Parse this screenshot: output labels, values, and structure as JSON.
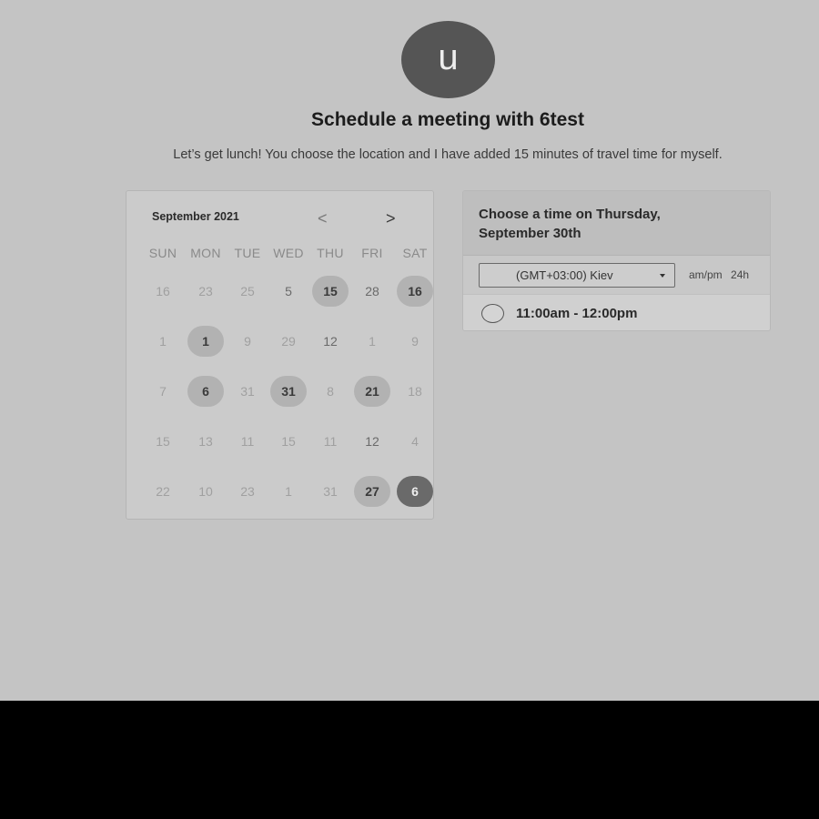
{
  "header": {
    "avatar_letter": "u",
    "title": "Schedule a meeting with 6test",
    "description": "Let’s get lunch! You choose the location and I have added 15 minutes of travel time for myself."
  },
  "calendar": {
    "month_label": "September 2021",
    "prev_glyph": "<",
    "next_glyph": ">",
    "weekdays": [
      "SUN",
      "MON",
      "TUE",
      "WED",
      "THU",
      "FRI",
      "SAT"
    ],
    "weeks": [
      [
        {
          "label": "16",
          "state": "muted"
        },
        {
          "label": "23",
          "state": "muted"
        },
        {
          "label": "25",
          "state": "muted"
        },
        {
          "label": "5",
          "state": "mid"
        },
        {
          "label": "15",
          "state": "available"
        },
        {
          "label": "28",
          "state": "mid"
        },
        {
          "label": "16",
          "state": "available"
        }
      ],
      [
        {
          "label": "1",
          "state": "muted"
        },
        {
          "label": "1",
          "state": "available"
        },
        {
          "label": "9",
          "state": "muted"
        },
        {
          "label": "29",
          "state": "muted"
        },
        {
          "label": "12",
          "state": "mid"
        },
        {
          "label": "1",
          "state": "muted"
        },
        {
          "label": "9",
          "state": "muted"
        }
      ],
      [
        {
          "label": "7",
          "state": "muted"
        },
        {
          "label": "6",
          "state": "available"
        },
        {
          "label": "31",
          "state": "muted"
        },
        {
          "label": "31",
          "state": "available"
        },
        {
          "label": "8",
          "state": "muted"
        },
        {
          "label": "21",
          "state": "available"
        },
        {
          "label": "18",
          "state": "muted"
        }
      ],
      [
        {
          "label": "15",
          "state": "muted"
        },
        {
          "label": "13",
          "state": "muted"
        },
        {
          "label": "11",
          "state": "muted"
        },
        {
          "label": "15",
          "state": "muted"
        },
        {
          "label": "11",
          "state": "muted"
        },
        {
          "label": "12",
          "state": "mid"
        },
        {
          "label": "4",
          "state": "muted"
        }
      ],
      [
        {
          "label": "22",
          "state": "muted"
        },
        {
          "label": "10",
          "state": "muted"
        },
        {
          "label": "23",
          "state": "muted"
        },
        {
          "label": "1",
          "state": "muted"
        },
        {
          "label": "31",
          "state": "muted"
        },
        {
          "label": "27",
          "state": "available"
        },
        {
          "label": "6",
          "state": "selected"
        }
      ]
    ]
  },
  "time_panel": {
    "title": "Choose a time on Thursday, September 30th",
    "timezone": "(GMT+03:00) Kiev",
    "format_ampm": "am/pm",
    "format_24h": "24h",
    "slots": [
      "11:00am - 12:00pm"
    ]
  },
  "colors": {
    "page_background": "#c4c4c4",
    "avatar": "#555555",
    "available_day": "#b2b2b2",
    "selected_day": "#6a6a6a"
  }
}
